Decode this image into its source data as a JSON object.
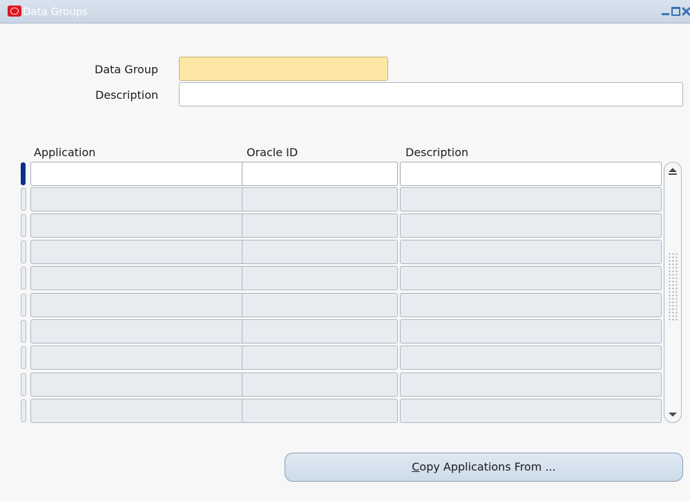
{
  "window": {
    "title": "Data Groups",
    "controls": {
      "minimize_icon": "minimize-icon",
      "maximize_icon": "maximize-icon",
      "close_icon": "close-icon"
    },
    "app_icon": "oracle-icon"
  },
  "header_form": {
    "data_group_label": "Data Group",
    "data_group_value": "",
    "description_label": "Description",
    "description_value": ""
  },
  "table": {
    "columns": [
      "Application",
      "Oracle ID",
      "Description"
    ],
    "rows": [
      {
        "application": "",
        "oracle_id": "",
        "description": ""
      },
      {
        "application": "",
        "oracle_id": "",
        "description": ""
      },
      {
        "application": "",
        "oracle_id": "",
        "description": ""
      },
      {
        "application": "",
        "oracle_id": "",
        "description": ""
      },
      {
        "application": "",
        "oracle_id": "",
        "description": ""
      },
      {
        "application": "",
        "oracle_id": "",
        "description": ""
      },
      {
        "application": "",
        "oracle_id": "",
        "description": ""
      },
      {
        "application": "",
        "oracle_id": "",
        "description": ""
      },
      {
        "application": "",
        "oracle_id": "",
        "description": ""
      },
      {
        "application": "",
        "oracle_id": "",
        "description": ""
      }
    ]
  },
  "actions": {
    "copy_button_mnemonic": "C",
    "copy_button_rest": "opy Applications From ..."
  },
  "colors": {
    "required_field": "#fce6a4",
    "current_record_indicator": "#0d2f8a",
    "titlebar": "#c9d6e4"
  }
}
